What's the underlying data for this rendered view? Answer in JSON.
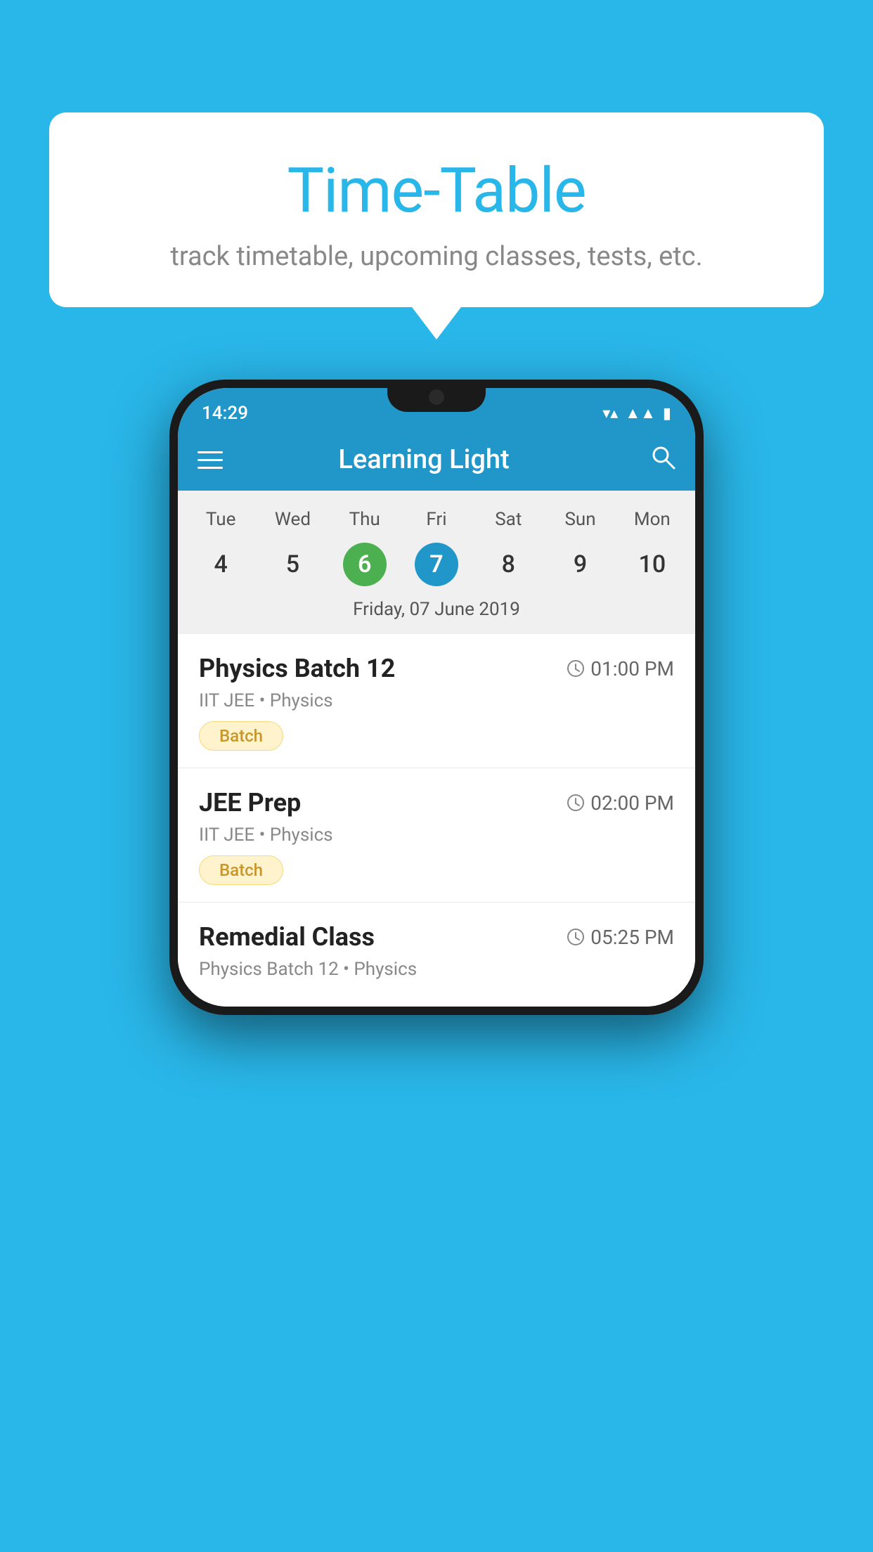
{
  "background_color": "#29b6e8",
  "bubble": {
    "title": "Time-Table",
    "subtitle": "track timetable, upcoming classes, tests, etc."
  },
  "phone": {
    "status_bar": {
      "time": "14:29",
      "wifi": "▼▲",
      "signal": "▲",
      "battery": "▮"
    },
    "app_bar": {
      "title": "Learning Light",
      "menu_icon": "hamburger",
      "search_icon": "search"
    },
    "calendar": {
      "day_names": [
        "Tue",
        "Wed",
        "Thu",
        "Fri",
        "Sat",
        "Sun",
        "Mon"
      ],
      "dates": [
        4,
        5,
        6,
        7,
        8,
        9,
        10
      ],
      "today_index": 2,
      "selected_index": 3,
      "selected_label": "Friday, 07 June 2019"
    },
    "schedule": [
      {
        "title": "Physics Batch 12",
        "time": "01:00 PM",
        "detail": "IIT JEE • Physics",
        "badge": "Batch"
      },
      {
        "title": "JEE Prep",
        "time": "02:00 PM",
        "detail": "IIT JEE • Physics",
        "badge": "Batch"
      },
      {
        "title": "Remedial Class",
        "time": "05:25 PM",
        "detail": "Physics Batch 12 • Physics",
        "badge": null
      }
    ]
  }
}
